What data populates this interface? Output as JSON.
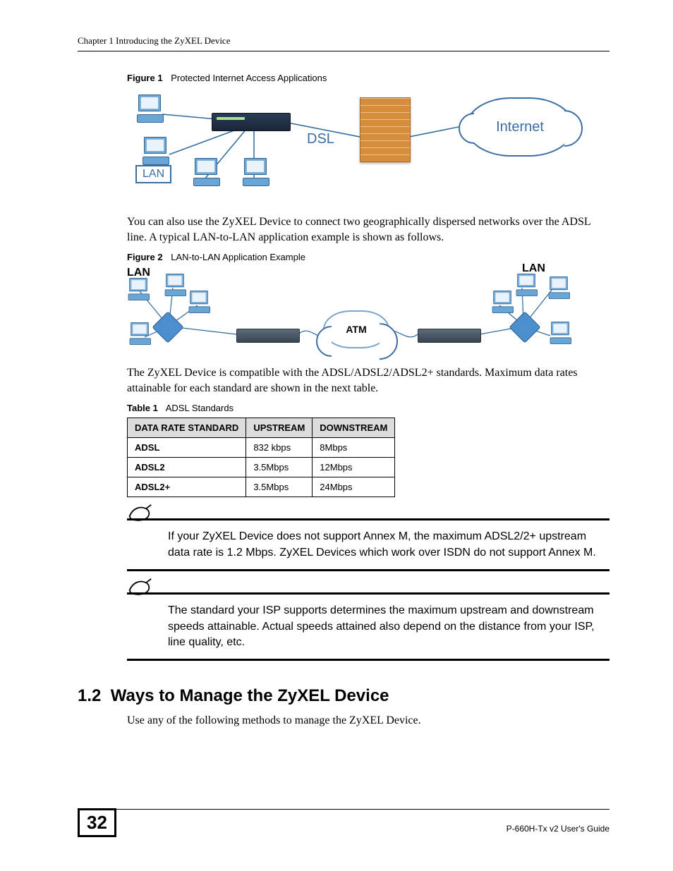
{
  "header": {
    "chapter_line": "Chapter 1 Introducing the ZyXEL Device"
  },
  "figure1": {
    "label": "Figure 1",
    "caption": "Protected Internet Access Applications",
    "labels": {
      "lan": "LAN",
      "dsl": "DSL",
      "internet": "Internet"
    }
  },
  "para1": "You can also use the ZyXEL Device to connect two geographically dispersed networks over the ADSL line. A typical LAN-to-LAN application example is shown as follows.",
  "figure2": {
    "label": "Figure 2",
    "caption": "LAN-to-LAN Application Example",
    "labels": {
      "lan_left": "LAN",
      "lan_right": "LAN",
      "atm": "ATM"
    }
  },
  "para2": "The ZyXEL Device is compatible with the ADSL/ADSL2/ADSL2+ standards. Maximum data rates attainable for each standard are shown in the next table.",
  "table1": {
    "label": "Table 1",
    "caption": "ADSL Standards",
    "headers": [
      "DATA RATE STANDARD",
      "UPSTREAM",
      "DOWNSTREAM"
    ],
    "rows": [
      {
        "std": "ADSL",
        "up": "832 kbps",
        "down": "8Mbps"
      },
      {
        "std": "ADSL2",
        "up": "3.5Mbps",
        "down": "12Mbps"
      },
      {
        "std": "ADSL2+",
        "up": "3.5Mbps",
        "down": "24Mbps"
      }
    ]
  },
  "note1": "If your ZyXEL Device does not support Annex M, the maximum ADSL2/2+ upstream data rate is 1.2 Mbps. ZyXEL Devices which work over ISDN do not support Annex M.",
  "note2": "The standard your ISP supports determines the maximum upstream and downstream speeds attainable. Actual speeds attained also depend on the distance from your ISP, line quality, etc.",
  "section": {
    "number": "1.2",
    "title": "Ways to Manage the ZyXEL Device"
  },
  "para3": "Use any of the following methods to manage the ZyXEL Device.",
  "footer": {
    "page": "32",
    "guide": "P-660H-Tx v2 User's Guide"
  }
}
